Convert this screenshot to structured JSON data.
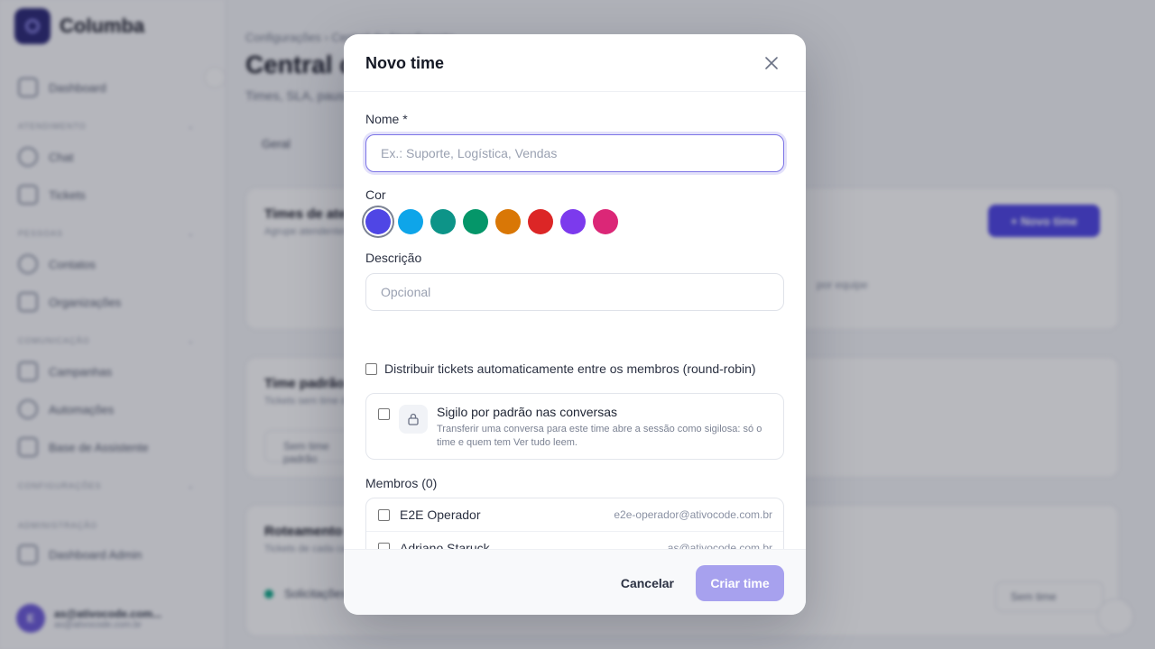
{
  "background": {
    "app_name": "Columba",
    "sidebar": {
      "items_top": [
        {
          "label": "Dashboard"
        }
      ],
      "sections": [
        {
          "title": "Atendimento",
          "items": [
            "Chat",
            "Tickets"
          ]
        },
        {
          "title": "Pessoas",
          "items": [
            "Contatos",
            "Organizações"
          ]
        },
        {
          "title": "Comunicação",
          "items": [
            "Campanhas",
            "Automações",
            "Base de Assistente"
          ]
        },
        {
          "title": "Configurações",
          "items": []
        },
        {
          "title": "Administração",
          "items": [
            "Dashboard Admin"
          ]
        }
      ],
      "user": {
        "initial": "E",
        "name": "as@ativocode.com...",
        "sub": "as@ativocode.com.br"
      }
    },
    "main": {
      "breadcrumb": "Configurações  ›  Central de Atendimento",
      "title": "Central de Atendimento",
      "subtitle": "Times, SLA, pausas e roteamento",
      "tab": "Geral",
      "card1": {
        "title": "Times de atendimento",
        "sub": "Agrupe atendentes por área",
        "button": "+ Novo time",
        "note": "por equipe"
      },
      "card2": {
        "title": "Time padrão",
        "sub": "Tickets sem time definido",
        "field": "Sem time padrão"
      },
      "card3": {
        "title": "Roteamento",
        "sub": "Tickets de cada canal",
        "status": "Solicitações",
        "select": "Sem time"
      }
    }
  },
  "modal": {
    "title": "Novo time",
    "name_label": "Nome *",
    "name_placeholder": "Ex.: Suporte, Logística, Vendas",
    "name_value": "",
    "color_label": "Cor",
    "colors": [
      "#4f46e5",
      "#0ea5e9",
      "#0d9488",
      "#059669",
      "#d97706",
      "#dc2626",
      "#7c3aed",
      "#db2777"
    ],
    "selected_color_index": 0,
    "description_label": "Descrição",
    "description_placeholder": "Opcional",
    "round_robin_label": "Distribuir tickets automaticamente entre os membros (round-robin)",
    "round_robin_checked": false,
    "secrecy": {
      "title": "Sigilo por padrão nas conversas",
      "description": "Transferir uma conversa para este time abre a sessão como sigilosa: só o time e quem tem Ver tudo leem.",
      "checked": false
    },
    "members_label": "Membros (0)",
    "members": [
      {
        "name": "E2E Operador",
        "email": "e2e-operador@ativocode.com.br",
        "checked": false
      },
      {
        "name": "Adriano Staruck",
        "email": "as@ativocode.com.br",
        "checked": false
      }
    ],
    "cancel_label": "Cancelar",
    "create_label": "Criar time"
  }
}
